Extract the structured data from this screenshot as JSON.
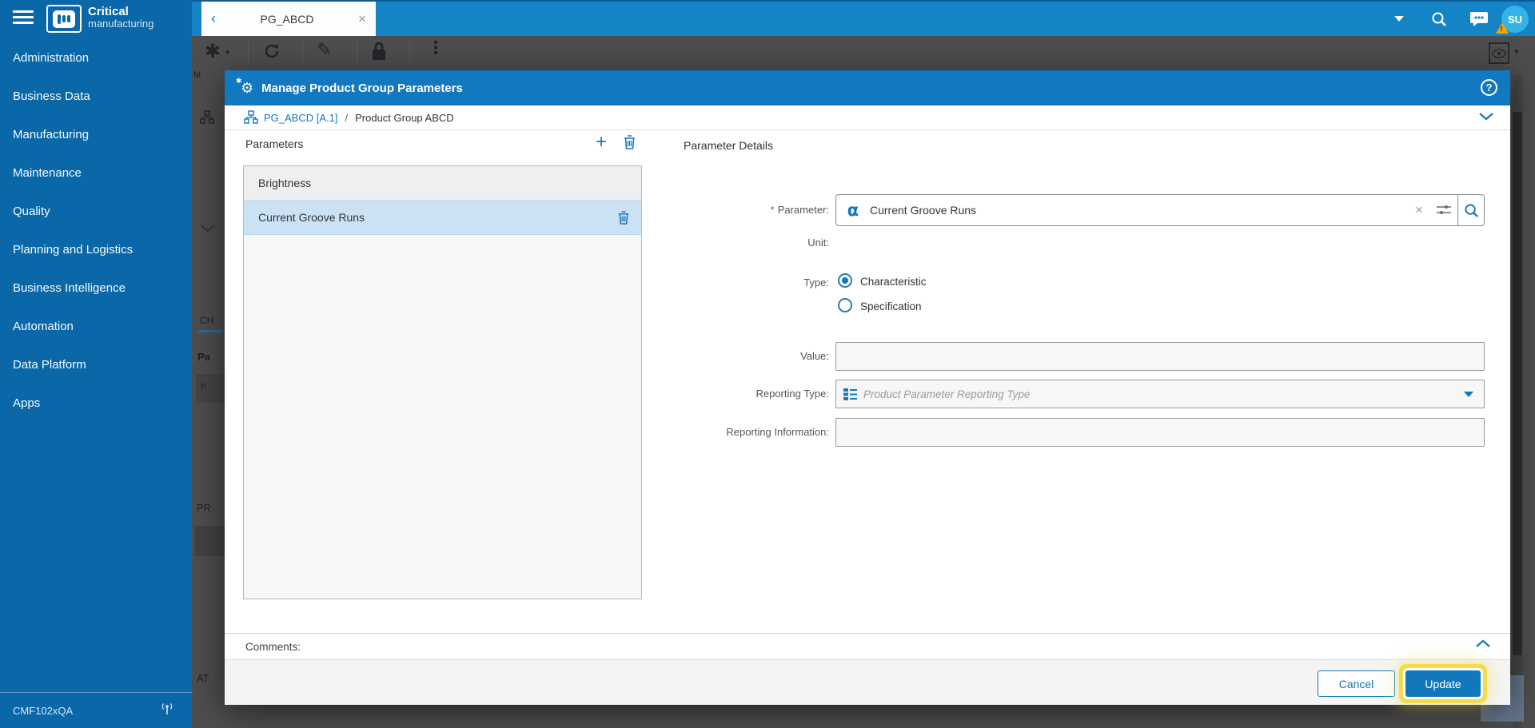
{
  "colors": {
    "accent": "#1377bd",
    "sidebar": "#0a68a8",
    "topbar": "#1484c6",
    "modal_header": "#1278bf",
    "selected_row": "#cbe2f4",
    "focus_ring": "#f2dd4e",
    "avatar": "#34b3e6",
    "warning_badge": "#f0a500"
  },
  "brand": {
    "line1": "Critical",
    "line2": "manufacturing"
  },
  "sidebar": {
    "items": [
      "Administration",
      "Business Data",
      "Manufacturing",
      "Maintenance",
      "Quality",
      "Planning and Logistics",
      "Business Intelligence",
      "Automation",
      "Data Platform",
      "Apps"
    ],
    "environment": "CMF102xQA"
  },
  "topbar": {
    "tab_label": "PG_ABCD",
    "tab_close": "×",
    "back_chevron": "‹",
    "avatar_initials": "SU"
  },
  "background_fragments": {
    "m": "M",
    "tab": "CH",
    "pa": "Pa",
    "p_box": "P.",
    "pr": "PR",
    "at": "AT"
  },
  "modal": {
    "title": "Manage Product Group Parameters",
    "help_glyph": "?",
    "gear_glyph": "⚙",
    "spark_glyph": "✱",
    "breadcrumb": {
      "link": "PG_ABCD [A.1]",
      "separator": "/",
      "current": "Product Group ABCD"
    },
    "parameters_panel": {
      "title": "Parameters",
      "add_glyph": "+",
      "items": [
        {
          "name": "Brightness",
          "selected": false
        },
        {
          "name": "Current Groove Runs",
          "selected": true
        }
      ]
    },
    "details": {
      "title": "Parameter Details",
      "required_marker": "*",
      "parameter_label": "Parameter:",
      "parameter_alpha_glyph": "α",
      "parameter_value": "Current Groove Runs",
      "parameter_clear_glyph": "×",
      "unit_label": "Unit:",
      "type_label": "Type:",
      "type_options": [
        {
          "label": "Characteristic",
          "selected": true
        },
        {
          "label": "Specification",
          "selected": false
        }
      ],
      "value_label": "Value:",
      "value_text": "",
      "reporting_type_label": "Reporting Type:",
      "reporting_type_placeholder": "Product Parameter Reporting Type",
      "reporting_information_label": "Reporting Information:",
      "reporting_information_text": ""
    },
    "comments_label": "Comments:",
    "footer": {
      "cancel_label": "Cancel",
      "update_label": "Update"
    }
  }
}
